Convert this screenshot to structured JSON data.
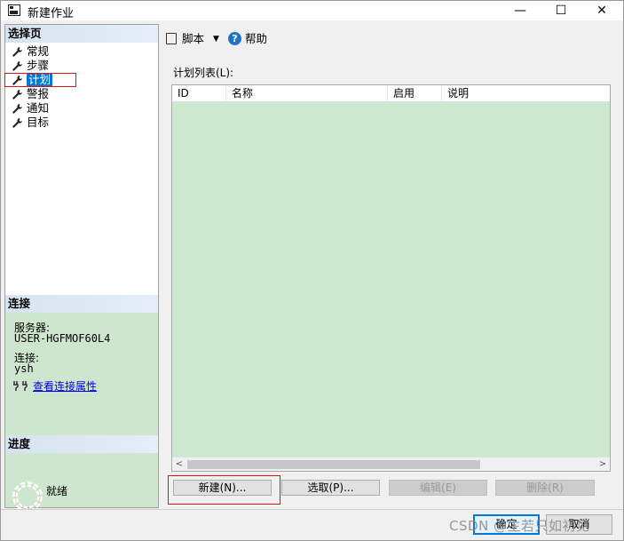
{
  "window": {
    "title": "新建作业",
    "minimize": "—",
    "maximize": "☐",
    "close": "✕"
  },
  "left": {
    "select_page_header": "选择页",
    "nav_items": [
      {
        "label": "常规",
        "icon": "wrench-icon"
      },
      {
        "label": "步骤",
        "icon": "wrench-icon"
      },
      {
        "label": "计划",
        "icon": "wrench-icon",
        "selected": true
      },
      {
        "label": "警报",
        "icon": "wrench-icon"
      },
      {
        "label": "通知",
        "icon": "wrench-icon"
      },
      {
        "label": "目标",
        "icon": "wrench-icon"
      }
    ],
    "connection_header": "连接",
    "server_label": "服务器:",
    "server_value": "USER-HGFMOF60L4",
    "connection_label": "连接:",
    "connection_value": "ysh",
    "view_props_link": "查看连接属性",
    "progress_header": "进度",
    "status": "就绪"
  },
  "toolbar": {
    "script_label": "脚本",
    "script_dropdown": "▼",
    "help_label": "帮助",
    "help_icon_glyph": "?"
  },
  "schedule_list": {
    "label": "计划列表(L):",
    "columns": [
      "ID",
      "名称",
      "启用",
      "说明"
    ],
    "rows": []
  },
  "scroll": {
    "left_arrow": "<",
    "right_arrow": ">"
  },
  "buttons": {
    "new": "新建(N)...",
    "pick": "选取(P)...",
    "edit": "编辑(E)",
    "delete": "删除(R)",
    "ok": "确定",
    "cancel": "取消"
  },
  "watermark": "CSDN @生若只如初见",
  "colors": {
    "accent": "#0078d7",
    "panel_green": "#cce8cf",
    "highlight_red": "#e01010"
  }
}
